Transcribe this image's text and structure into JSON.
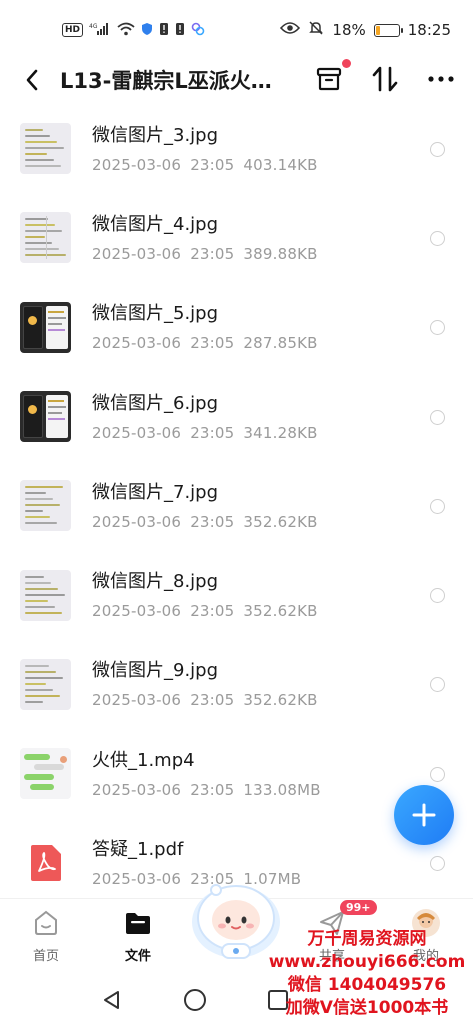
{
  "status_bar": {
    "hd": "HD",
    "net": "4G",
    "battery_percent": "18%",
    "battery_level": 0.18,
    "time": "18:25"
  },
  "header": {
    "title": "L13-雷麒宗L巫派火..."
  },
  "files": [
    {
      "name": "微信图片_3.jpg",
      "date": "2025-03-06",
      "time": "23:05",
      "size": "403.14KB",
      "thumb": "light"
    },
    {
      "name": "微信图片_4.jpg",
      "date": "2025-03-06",
      "time": "23:05",
      "size": "389.88KB",
      "thumb": "table"
    },
    {
      "name": "微信图片_5.jpg",
      "date": "2025-03-06",
      "time": "23:05",
      "size": "287.85KB",
      "thumb": "dark"
    },
    {
      "name": "微信图片_6.jpg",
      "date": "2025-03-06",
      "time": "23:05",
      "size": "341.28KB",
      "thumb": "dark"
    },
    {
      "name": "微信图片_7.jpg",
      "date": "2025-03-06",
      "time": "23:05",
      "size": "352.62KB",
      "thumb": "light"
    },
    {
      "name": "微信图片_8.jpg",
      "date": "2025-03-06",
      "time": "23:05",
      "size": "352.62KB",
      "thumb": "light"
    },
    {
      "name": "微信图片_9.jpg",
      "date": "2025-03-06",
      "time": "23:05",
      "size": "352.62KB",
      "thumb": "light"
    },
    {
      "name": "火供_1.mp4",
      "date": "2025-03-06",
      "time": "23:05",
      "size": "133.08MB",
      "thumb": "chat"
    },
    {
      "name": "答疑_1.pdf",
      "date": "2025-03-06",
      "time": "23:05",
      "size": "1.07MB",
      "thumb": "pdf"
    }
  ],
  "tabs": [
    {
      "label": "首页",
      "icon": "home-icon"
    },
    {
      "label": "文件",
      "icon": "folder-icon"
    },
    {
      "label": "共享",
      "icon": "share-icon"
    },
    {
      "label": "我的",
      "icon": "avatar"
    }
  ],
  "share_badge": "99+",
  "watermark": {
    "line1": "万千周易资源网",
    "line2": "www.zhouyi666.com",
    "line3": "微信 1404049576",
    "line4": "加微V信送1000本书"
  },
  "colors": {
    "accent": "#1f7cf5",
    "badge": "#f0445c",
    "battery": "#f5a623",
    "watermark": "#e0141e"
  }
}
